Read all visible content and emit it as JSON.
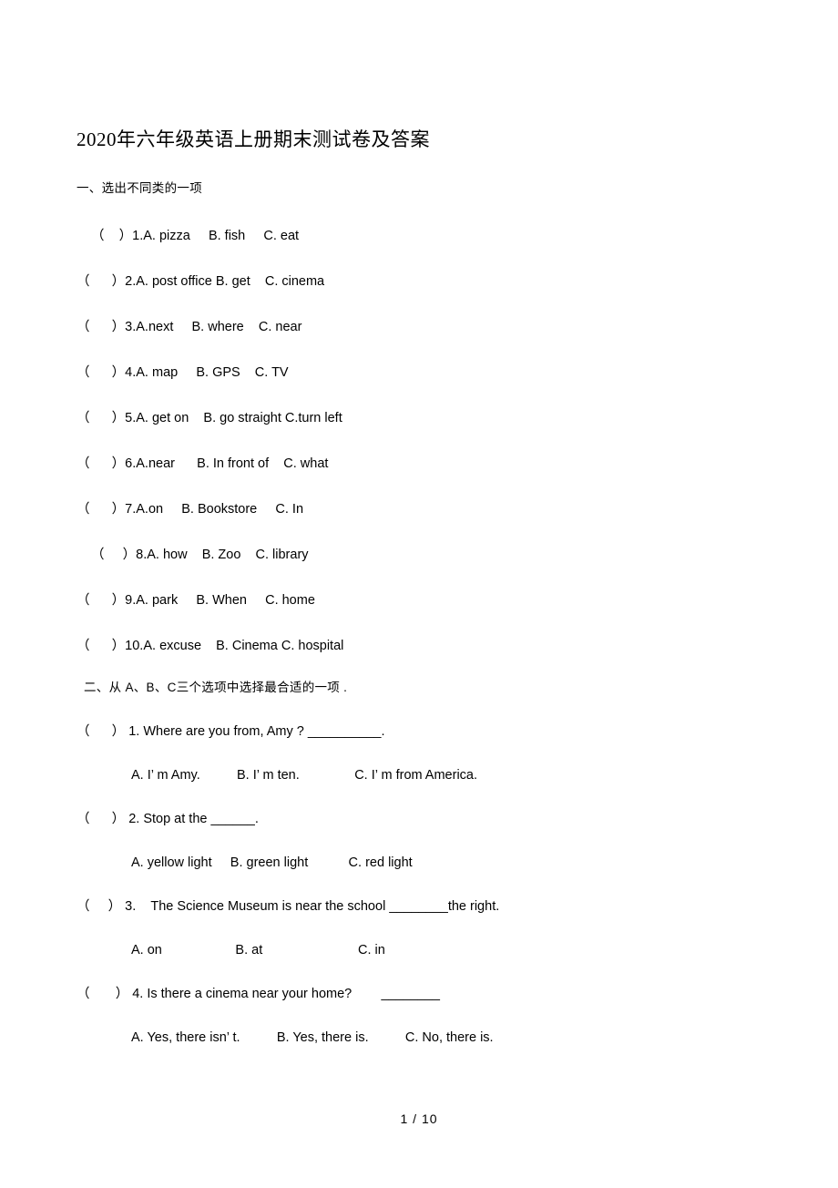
{
  "document": {
    "title": "2020年六年级英语上册期末测试卷及答案",
    "section1_heading": "一、选出不同类的一项",
    "section2_heading": "二、从 A、B、C三个选项中选择最合适的一项      .",
    "footer": "1 / 10"
  },
  "section1": [
    {
      "paren": "（    ）",
      "num": "1.",
      "text": "A. pizza     B. fish     C. eat",
      "indent": 16
    },
    {
      "paren": "（      ）",
      "num": "2.",
      "text": "A. post office B. get    C. cinema",
      "indent": 0
    },
    {
      "paren": "（      ）",
      "num": "3.",
      "text": "A.next     B. where    C. near",
      "indent": 0
    },
    {
      "paren": "（      ）",
      "num": "4.",
      "text": "A. map     B. GPS    C. TV",
      "indent": 0
    },
    {
      "paren": "（      ）",
      "num": "5.",
      "text": "A. get on    B. go straight C.turn left",
      "indent": 0
    },
    {
      "paren": "（      ）",
      "num": "6.",
      "text": "A.near      B. In front of    C. what",
      "indent": 0
    },
    {
      "paren": "（      ）",
      "num": "7.",
      "text": "A.on     B. Bookstore     C. In",
      "indent": 0
    },
    {
      "paren": "（     ）",
      "num": "8.",
      "text": "A. how    B. Zoo    C. library",
      "indent": 16
    },
    {
      "paren": "（      ）",
      "num": "9.",
      "text": "A. park     B. When     C. home",
      "indent": 0
    },
    {
      "paren": "（      ）",
      "num": "10.",
      "text": "A. excuse    B. Cinema C. hospital",
      "indent": 0
    }
  ],
  "section2": [
    {
      "question": "（      ） 1. Where are you from, Amy ? __________.",
      "options": "A. I’ m Amy.          B. I’ m ten.               C. I’ m from America."
    },
    {
      "question": "（      ） 2. Stop at the ______.",
      "options": "A. yellow light     B. green light           C. red light"
    },
    {
      "question": "（     ） 3.    The Science Museum is near the school ________the right.",
      "options": "A. on                    B. at                          C. in"
    },
    {
      "question": "（       ） 4. Is there a cinema near your home?        ________",
      "options": "A. Yes, there isn’ t.          B. Yes, there is.          C. No, there is."
    }
  ]
}
